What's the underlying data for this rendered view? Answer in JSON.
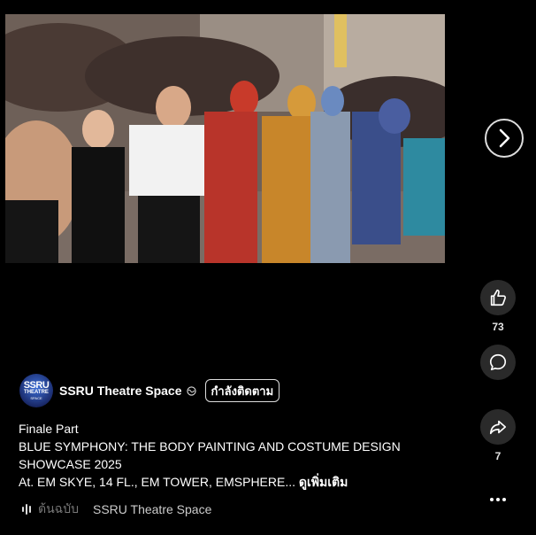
{
  "post": {
    "author": "SSRU Theatre Space",
    "follow_label": "กำลังติดตาม",
    "avatar_text": {
      "line1": "SSRU",
      "line2": "THEATRE",
      "line3": "SPACE"
    },
    "caption_lines": [
      "Finale Part",
      "BLUE SYMPHONY: THE BODY PAINTING AND COSTUME DESIGN",
      "SHOWCASE 2025",
      "At. EM SKYE, 14 FL., EM TOWER, EMSPHERE..."
    ],
    "see_more_label": "ดูเพิ่มเติม"
  },
  "actions": {
    "like_count": "73",
    "share_count": "7"
  },
  "audio": {
    "prefix": "ต้นฉบับ",
    "name": "SSRU Theatre Space"
  },
  "icons": {
    "next": "chevron-right-icon",
    "like": "thumbs-up-icon",
    "comment": "comment-icon",
    "share": "share-icon",
    "more": "more-horizontal-icon",
    "privacy": "globe-icon",
    "audio": "audio-bars-icon"
  }
}
